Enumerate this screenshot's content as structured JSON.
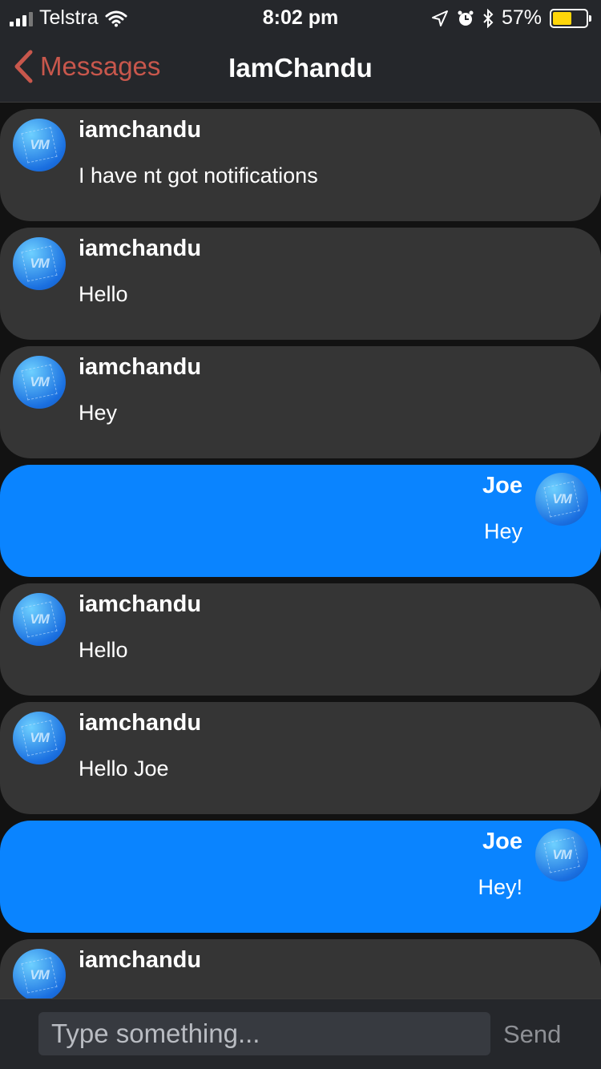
{
  "status_bar": {
    "carrier": "Telstra",
    "time": "8:02 pm",
    "battery_percent": "57%",
    "battery_level": 0.57,
    "battery_color": "#ffd60a"
  },
  "nav": {
    "back_label": "Messages",
    "title": "IamChandu"
  },
  "colors": {
    "incoming_bubble": "#353535",
    "outgoing_bubble": "#0a84ff",
    "accent": "#c8574c"
  },
  "messages": [
    {
      "sender": "iamchandu",
      "text": "I have nt got notifications",
      "direction": "incoming",
      "avatar_icon": "vm-logo-avatar-icon",
      "avatar_text": "VM"
    },
    {
      "sender": "iamchandu",
      "text": "Hello",
      "direction": "incoming",
      "avatar_icon": "vm-logo-avatar-icon",
      "avatar_text": "VM"
    },
    {
      "sender": "iamchandu",
      "text": "Hey",
      "direction": "incoming",
      "avatar_icon": "vm-logo-avatar-icon",
      "avatar_text": "VM"
    },
    {
      "sender": "Joe",
      "text": "Hey",
      "direction": "outgoing",
      "avatar_icon": "vm-logo-avatar-icon",
      "avatar_text": "VM"
    },
    {
      "sender": "iamchandu",
      "text": "Hello",
      "direction": "incoming",
      "avatar_icon": "vm-logo-avatar-icon",
      "avatar_text": "VM"
    },
    {
      "sender": "iamchandu",
      "text": "Hello Joe",
      "direction": "incoming",
      "avatar_icon": "vm-logo-avatar-icon",
      "avatar_text": "VM"
    },
    {
      "sender": "Joe",
      "text": "Hey!",
      "direction": "outgoing",
      "avatar_icon": "vm-logo-avatar-icon",
      "avatar_text": "VM"
    },
    {
      "sender": "iamchandu",
      "text": "",
      "direction": "incoming",
      "avatar_icon": "vm-logo-avatar-icon",
      "avatar_text": "VM"
    }
  ],
  "composer": {
    "placeholder": "Type something...",
    "value": "",
    "send_label": "Send"
  }
}
